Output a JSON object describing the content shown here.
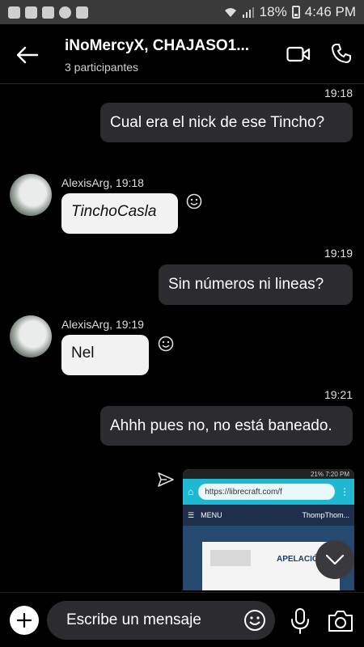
{
  "status_bar": {
    "battery": "18%",
    "time": "4:46 PM"
  },
  "header": {
    "title": "iNoMercyX, CHAJASO1...",
    "subtitle": "3 participantes"
  },
  "messages": [
    {
      "time": "19:18",
      "text": "Cual era el nick de ese Tincho?"
    },
    {
      "sender": "AlexisArg, 19:18",
      "text": "TinchoCasla"
    },
    {
      "time": "19:19",
      "text": "Sin números ni lineas?"
    },
    {
      "sender": "AlexisArg, 19:19",
      "text": "Nel"
    },
    {
      "time": "19:21",
      "text": "Ahhh pues no, no está baneado."
    }
  ],
  "attachment": {
    "status_left": "",
    "status_right": "21% 7:20 PM",
    "url": "https://librecraft.com/f",
    "menu": "MENU",
    "user": "ThompThom...",
    "card_text": "APELACIÓ"
  },
  "input": {
    "placeholder": "Escribe un mensaje"
  },
  "colors": {
    "background": "#000000",
    "bubble_out": "#2c2c30",
    "bubble_in": "#f2f2f2",
    "site_accent": "#1fb8d2"
  }
}
